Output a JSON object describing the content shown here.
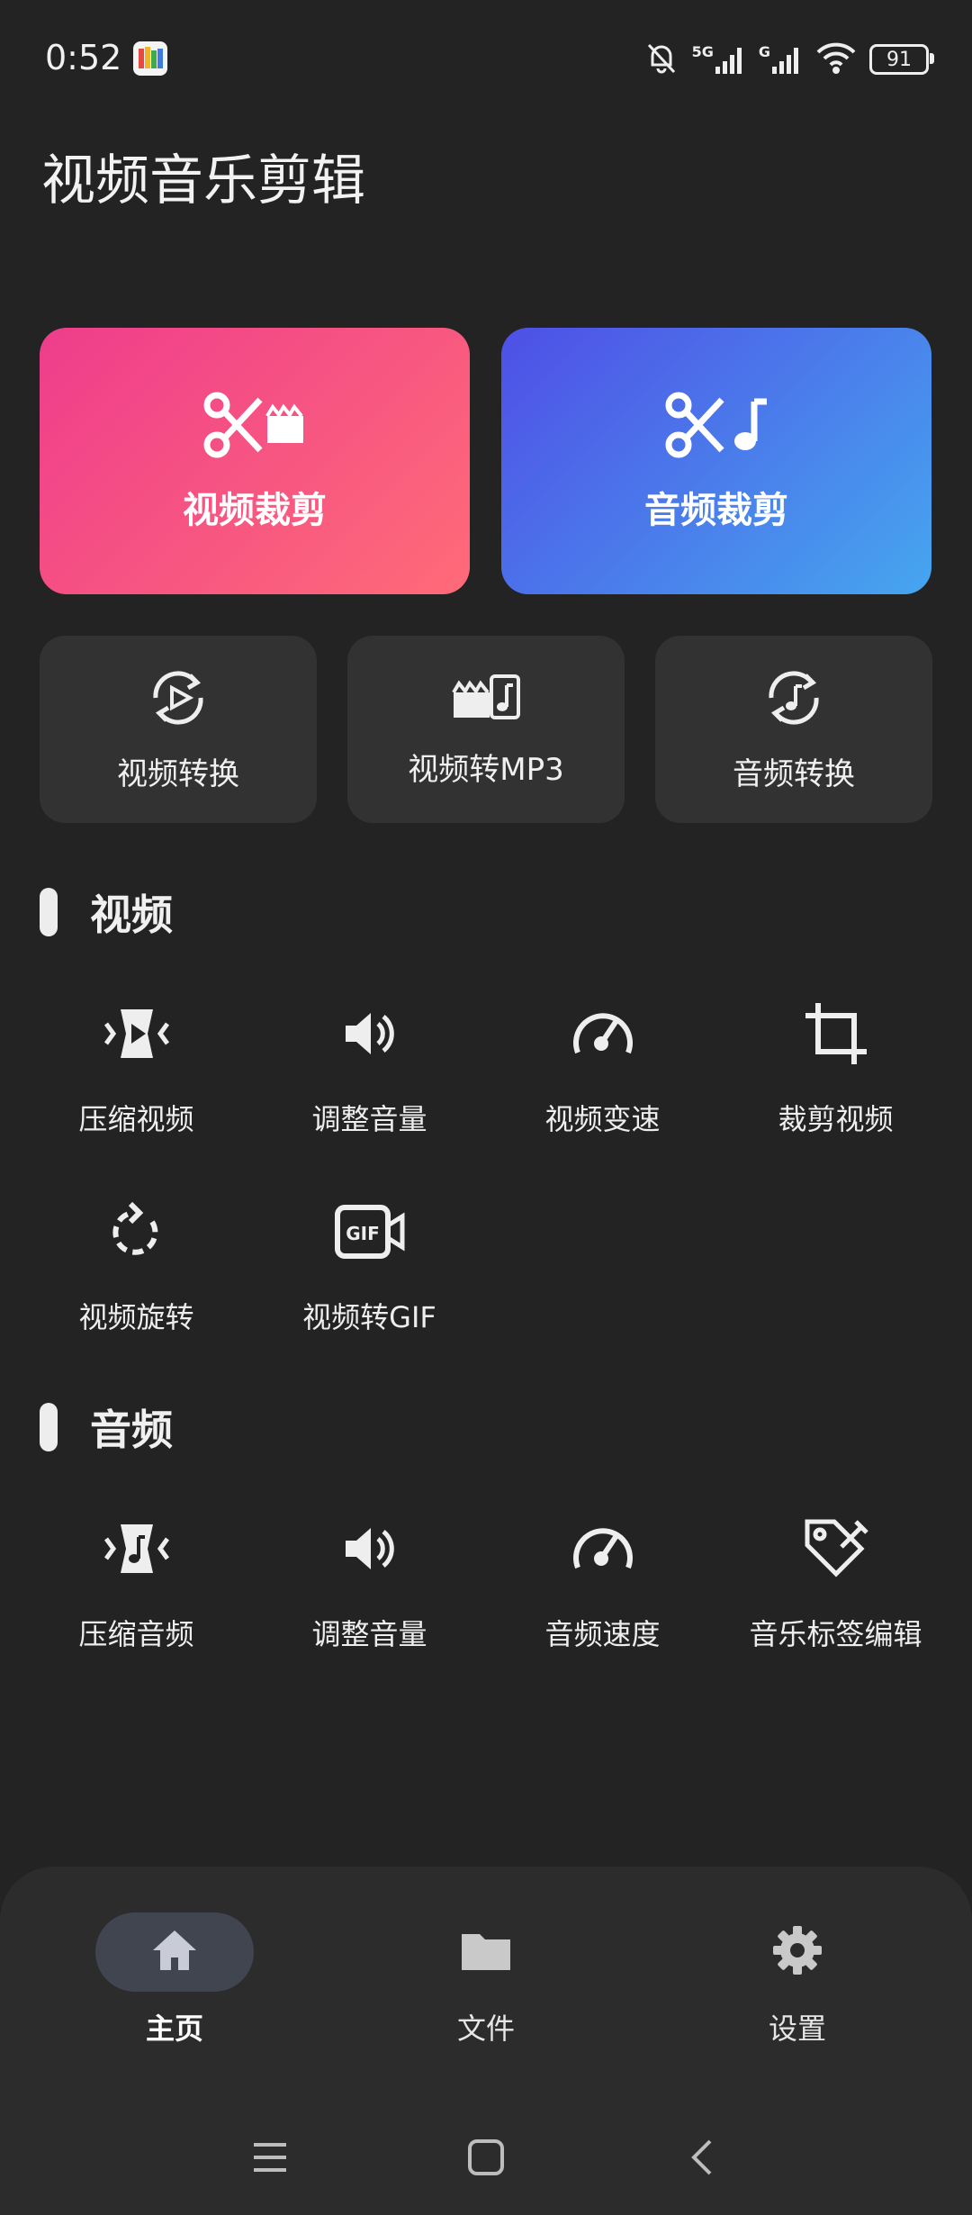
{
  "status_bar": {
    "time": "0:52",
    "battery": "91",
    "net1": "5G",
    "net2": "G"
  },
  "app": {
    "title": "视频音乐剪辑"
  },
  "primary_actions": {
    "video_crop": "视频裁剪",
    "audio_crop": "音频裁剪"
  },
  "secondary_actions": {
    "video_convert": "视频转换",
    "video_to_mp3": "视频转MP3",
    "audio_convert": "音频转换"
  },
  "video_section": {
    "title": "视频",
    "tools": [
      "压缩视频",
      "调整音量",
      "视频变速",
      "裁剪视频",
      "视频旋转",
      "视频转GIF"
    ]
  },
  "audio_section": {
    "title": "音频",
    "tools": [
      "压缩音频",
      "调整音量",
      "音频速度",
      "音乐标签编辑"
    ]
  },
  "bottom_nav": {
    "home": "主页",
    "files": "文件",
    "settings": "设置"
  },
  "colors": {
    "background": "#232323",
    "video_card_start": "#ee3d8c",
    "video_card_end": "#ff6b78",
    "audio_card_start": "#4f4fe6",
    "audio_card_end": "#46a6ef",
    "active_nav_pill": "#414550"
  }
}
